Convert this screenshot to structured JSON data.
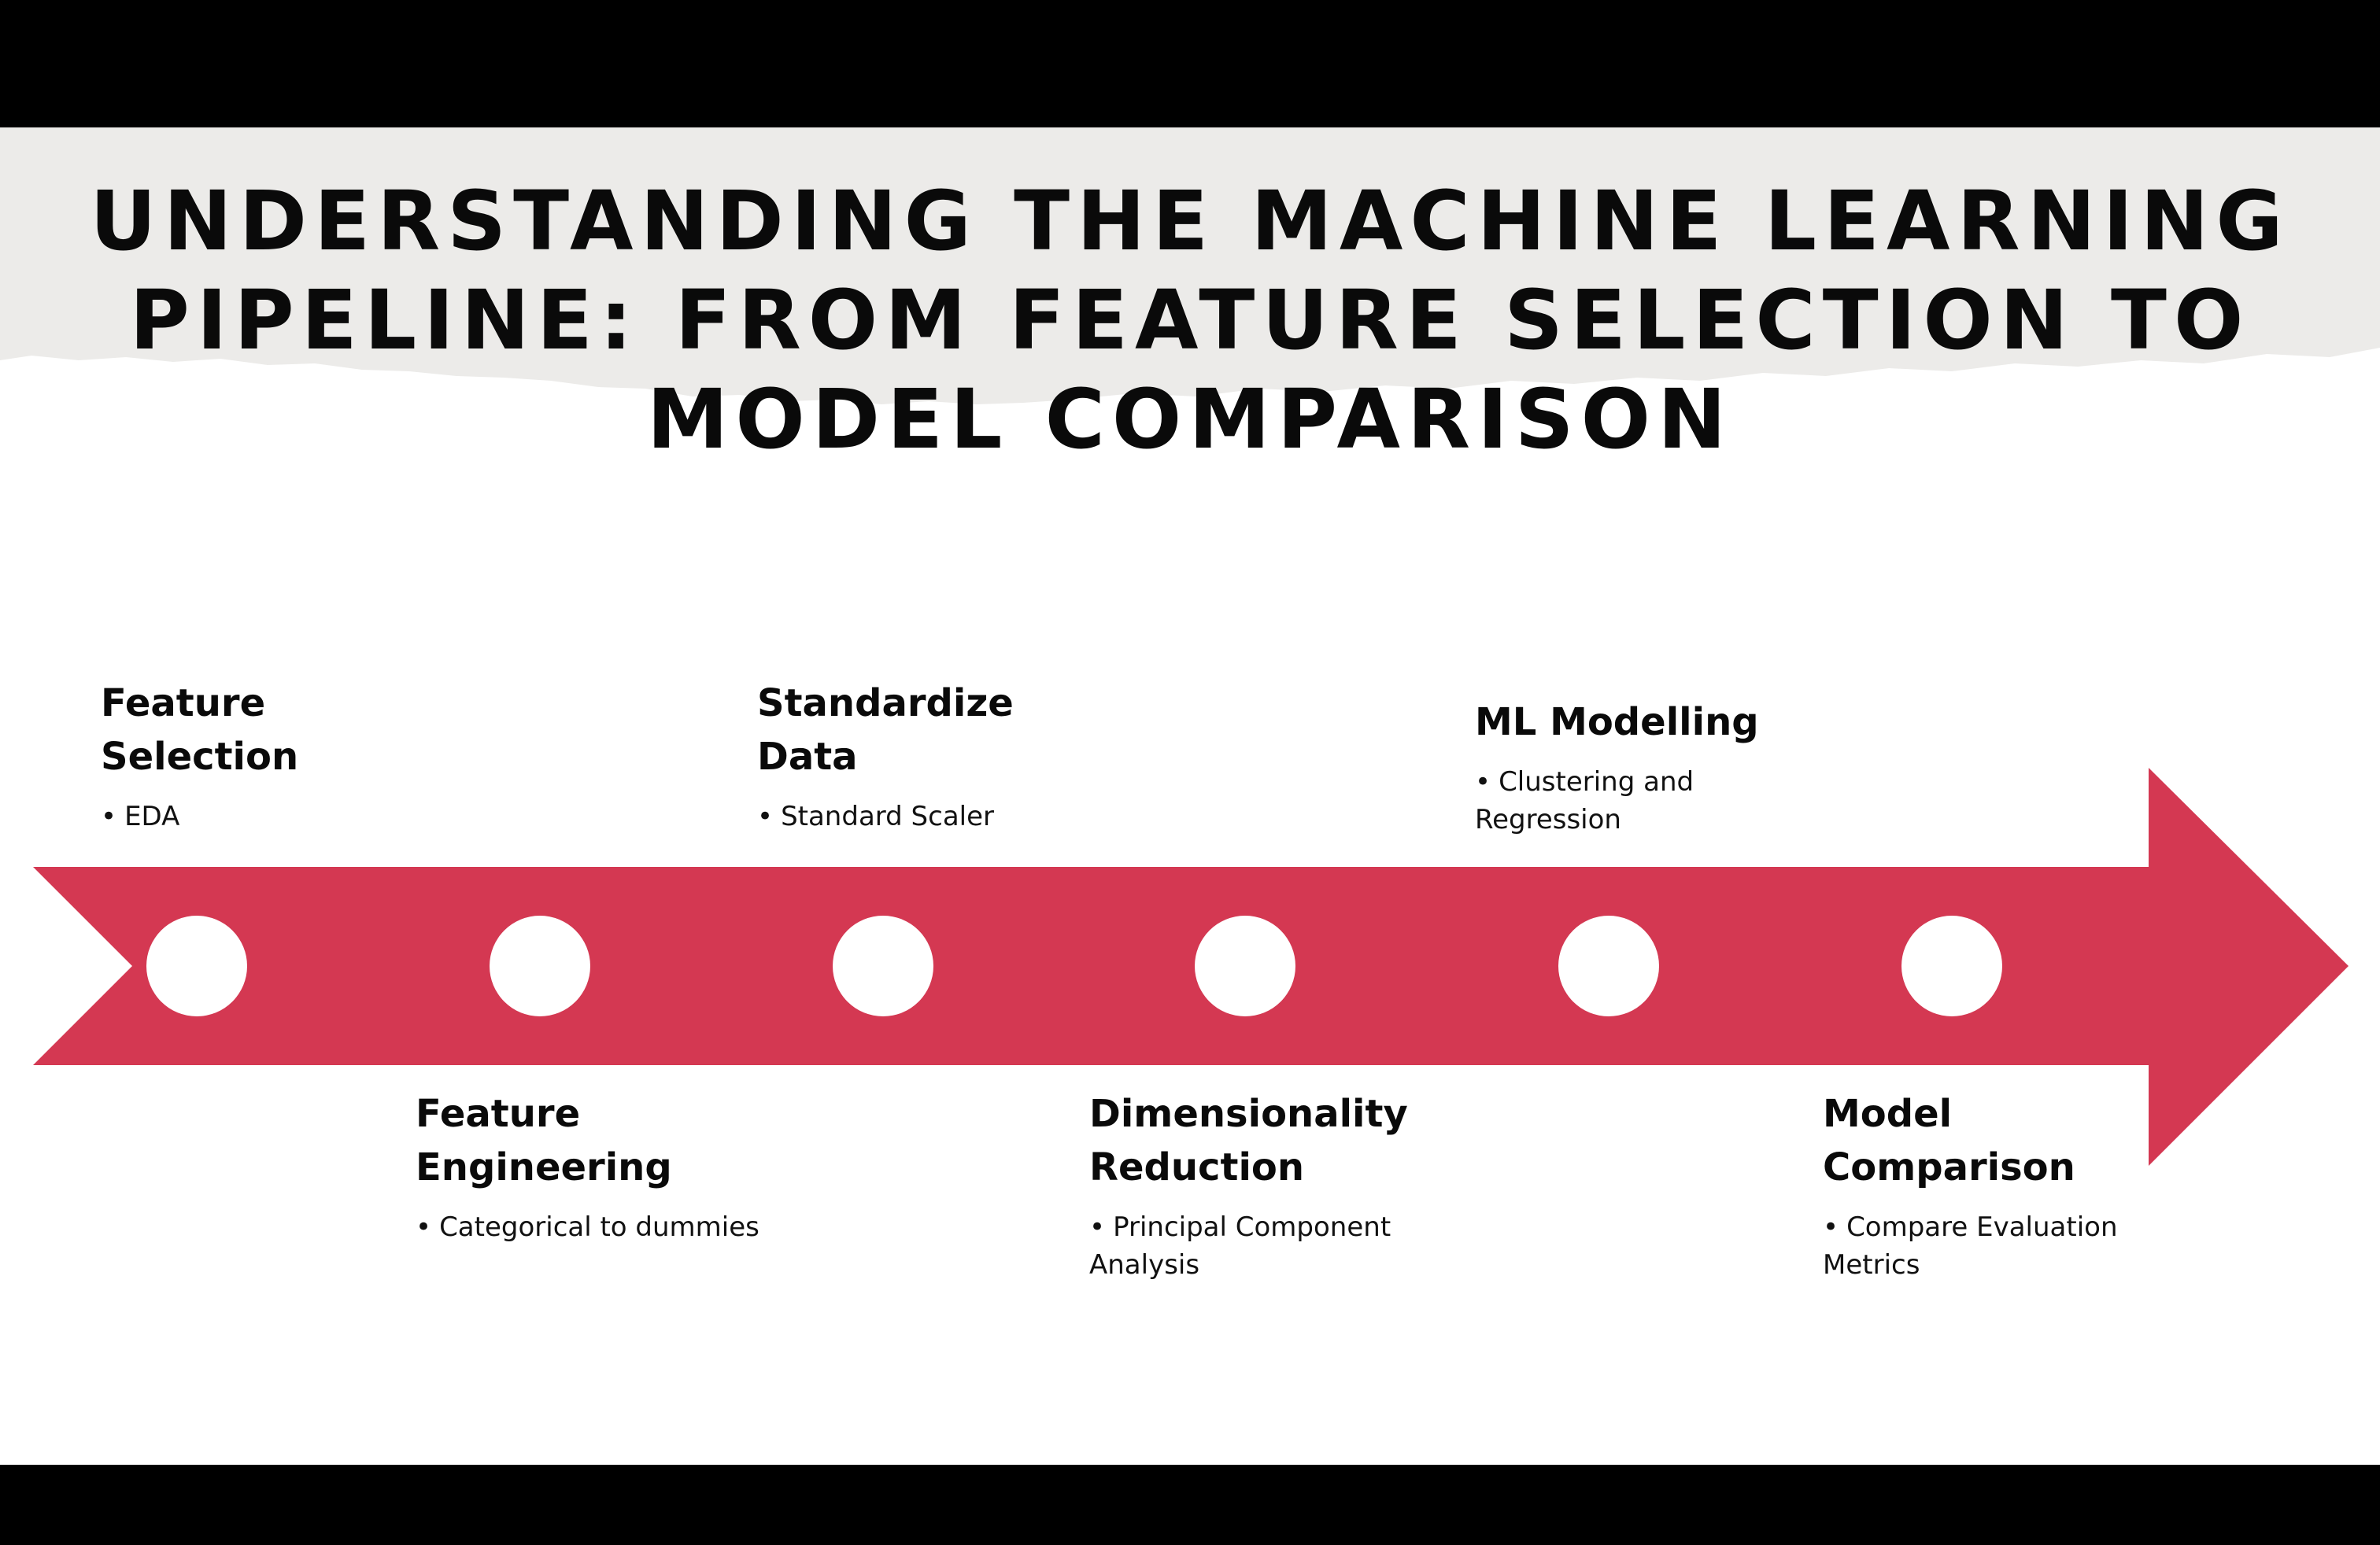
{
  "title": "UNDERSTANDING THE MACHINE LEARNING PIPELINE: FROM FEATURE SELECTION TO MODEL COMPARISON",
  "colors": {
    "arrow": "#d43852",
    "header_paper": "#ecebe9",
    "frame": "#000000",
    "node": "#ffffff"
  },
  "stages": [
    {
      "title": "Feature Selection",
      "bullet": "EDA"
    },
    {
      "title": "Feature Engineering",
      "bullet": "Categorical to dummies"
    },
    {
      "title": "Standardize Data",
      "bullet": "Standard Scaler"
    },
    {
      "title": "Dimensionality Reduction",
      "bullet": "Principal Component Analysis"
    },
    {
      "title": "ML Modelling",
      "bullet": "Clustering and Regression"
    },
    {
      "title": "Model Comparison",
      "bullet": "Compare Evaluation Metrics"
    }
  ]
}
